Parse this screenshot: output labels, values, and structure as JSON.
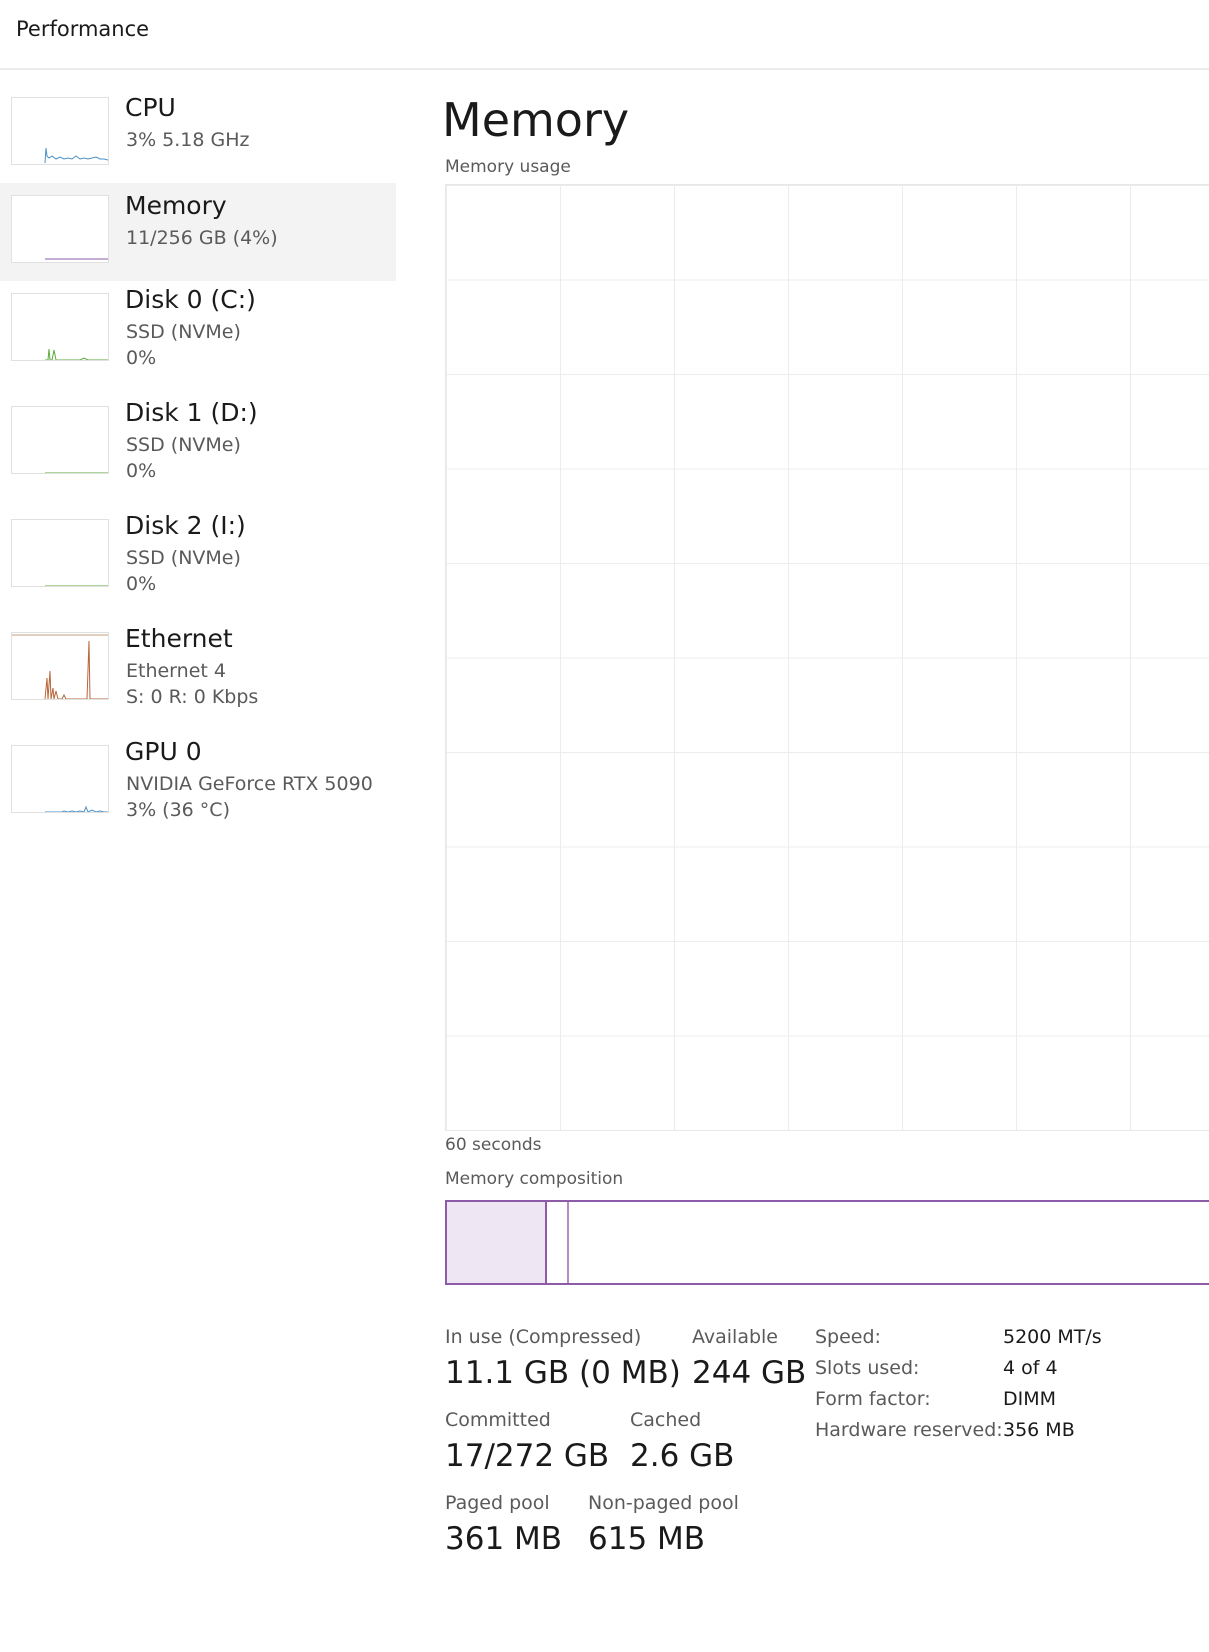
{
  "header": {
    "title": "Performance"
  },
  "sidebar": {
    "items": [
      {
        "name": "CPU",
        "sub1": "3%  5.18 GHz",
        "sub2": ""
      },
      {
        "name": "Memory",
        "sub1": "11/256 GB (4%)",
        "sub2": ""
      },
      {
        "name": "Disk 0 (C:)",
        "sub1": "SSD (NVMe)",
        "sub2": "0%"
      },
      {
        "name": "Disk 1 (D:)",
        "sub1": "SSD (NVMe)",
        "sub2": "0%"
      },
      {
        "name": "Disk 2 (I:)",
        "sub1": "SSD (NVMe)",
        "sub2": "0%"
      },
      {
        "name": "Ethernet",
        "sub1": "Ethernet 4",
        "sub2": "S: 0  R: 0 Kbps"
      },
      {
        "name": "GPU 0",
        "sub1": "NVIDIA GeForce RTX 5090",
        "sub2": "3%  (36 °C)"
      }
    ]
  },
  "main": {
    "title": "Memory",
    "usage_label": "Memory usage",
    "time_label": "60 seconds",
    "composition_label": "Memory composition",
    "composition": {
      "in_use_fraction": 0.043,
      "modified_fraction": 0.0
    },
    "stats": {
      "in_use_label": "In use (Compressed)",
      "in_use_value": "11.1 GB (0 MB)",
      "available_label": "Available",
      "available_value": "244 GB",
      "committed_label": "Committed",
      "committed_value": "17/272 GB",
      "cached_label": "Cached",
      "cached_value": "2.6 GB",
      "paged_label": "Paged pool",
      "paged_value": "361 MB",
      "nonpaged_label": "Non-paged pool",
      "nonpaged_value": "615 MB"
    },
    "specs": {
      "speed_label": "Speed:",
      "speed_value": "5200 MT/s",
      "slots_label": "Slots used:",
      "slots_value": "4 of 4",
      "form_label": "Form factor:",
      "form_value": "DIMM",
      "reserved_label": "Hardware reserved:",
      "reserved_value": "356 MB"
    }
  },
  "colors": {
    "cpu": "#4a90c8",
    "memory": "#8e5ba8",
    "disk": "#5cab3c",
    "ethernet": "#b8653a",
    "gpu": "#4a90c8"
  }
}
